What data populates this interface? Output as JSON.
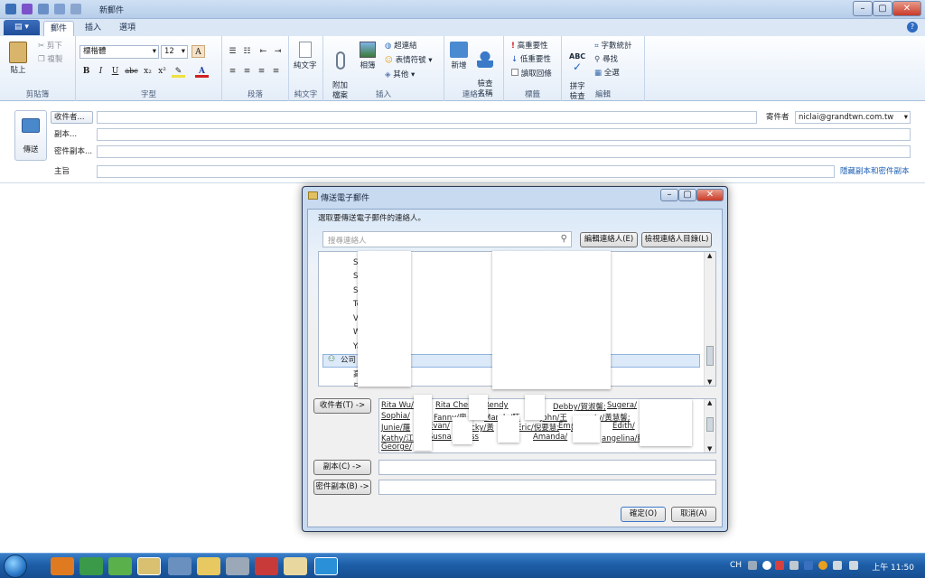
{
  "window": {
    "title": "新郵件",
    "controls": [
      "–",
      "▢",
      "✕"
    ]
  },
  "ribbon_tabs": {
    "file": "▤ ▾",
    "tabs": [
      "郵件",
      "插入",
      "選項"
    ]
  },
  "ribbon": {
    "clipboard": {
      "paste": "貼上",
      "cut": "剪下",
      "copy": "複製",
      "label": "剪貼簿"
    },
    "font": {
      "family": "標楷體",
      "size": "12",
      "label": "字型",
      "bold": "B",
      "italic": "I",
      "underline": "U",
      "strike": "abc",
      "sub": "x₂",
      "sup": "x²",
      "color": "A"
    },
    "paragraph": {
      "label": "段落"
    },
    "plaintext": {
      "btn": "純文字",
      "label": "純文字"
    },
    "insert": {
      "attach": "附加\n檔案",
      "photo": "相簿",
      "hyperlink": "超連結",
      "emoticon": "表情符號",
      "other": "其他",
      "label": "插入"
    },
    "contacts": {
      "add": "新增",
      "check": "檢查\n名稱",
      "label": "連絡人"
    },
    "tags": {
      "high": "高重要性",
      "low": "低重要性",
      "receipt": "讀取回條",
      "label": "標籤"
    },
    "editing": {
      "spell": "拼字\n檢查",
      "count": "字數統計",
      "find": "尋找",
      "selectall": "全選",
      "abc": "ABC",
      "label": "編輯"
    }
  },
  "compose": {
    "send": "傳送",
    "to_btn": "收件者...",
    "cc": "副本...",
    "bcc": "密件副本...",
    "subject": "主旨",
    "from_label": "寄件者",
    "from_value": "niclai@grandtwn.com.tw",
    "show_bcc_link": "隱藏副本和密件副本"
  },
  "dialog": {
    "title": "傳送電子郵件",
    "instruction": "選取要傳送電子郵件的連絡人。",
    "search_placeholder": "搜尋連絡人",
    "edit_btn": "編輯連絡人(E)",
    "view_dir_btn": "檢視連絡人目錄(L)",
    "contacts": [
      "Stanl",
      "Suge",
      "Susn",
      "Tony",
      "Vince",
      "Winn",
      "Yaki/",
      "公司",
      "高雄/",
      "台中"
    ],
    "to_btn": "收件者(T) ->",
    "cc_btn": "副本(C) ->",
    "bcc_btn": "密件副本(B) ->",
    "recipients": [
      {
        "text": "Rita Wu/",
        "row": 0
      },
      {
        "text": "Rita Cher",
        "row": 0
      },
      {
        "text": "Rendy",
        "row": 0
      },
      {
        "text": "Debby/賀淑馨;",
        "row": 0
      },
      {
        "text": "Sugera/",
        "row": 0
      },
      {
        "text": "Sophia/",
        "row": 1
      },
      {
        "text": "Fanny/廖",
        "row": 1
      },
      {
        "text": "Mandy/陳",
        "row": 1
      },
      {
        "text": "John/王",
        "row": 1
      },
      {
        "text": "ty/黃慧馨;",
        "row": 1
      },
      {
        "text": "Junie/羅",
        "row": 2
      },
      {
        "text": "Evan/",
        "row": 2
      },
      {
        "text": "acky/黃",
        "row": 2
      },
      {
        "text": "Eric/倪要慧;",
        "row": 2
      },
      {
        "text": "Em",
        "row": 2
      },
      {
        "text": "婉蓮;",
        "row": 2
      },
      {
        "text": "Edith/",
        "row": 2
      },
      {
        "text": "Kathy/江",
        "row": 3
      },
      {
        "text": "Susna",
        "row": 3
      },
      {
        "text": "Bess",
        "row": 3
      },
      {
        "text": "Amanda/",
        "row": 3
      },
      {
        "text": "angelina/賴",
        "row": 3
      },
      {
        "text": "George/",
        "row": 4
      }
    ],
    "ok": "確定(O)",
    "cancel": "取消(A)"
  },
  "taskbar": {
    "lang": "CH",
    "clock": "上午 11:50"
  }
}
